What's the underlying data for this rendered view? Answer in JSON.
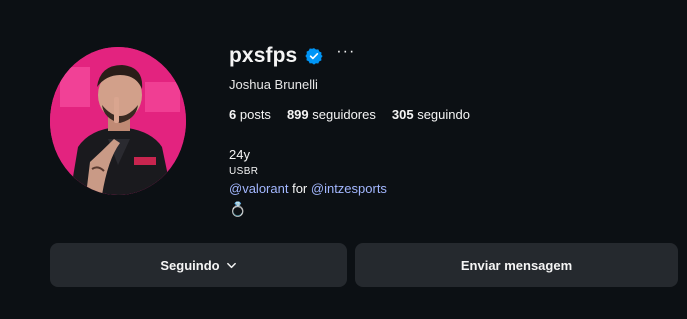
{
  "profile": {
    "username": "pxsfps",
    "full_name": "Joshua Brunelli",
    "more_label": "···",
    "stats": [
      {
        "count": "6",
        "label": "posts"
      },
      {
        "count": "899",
        "label": "seguidores"
      },
      {
        "count": "305",
        "label": "seguindo"
      }
    ],
    "bio": {
      "age": "24y",
      "region": "USBR",
      "mention_game": "@valorant",
      "for_text": "for",
      "mention_team": "@intzesports",
      "ring_emoji": "💍"
    },
    "buttons": {
      "following_label": "Seguindo",
      "message_label": "Enviar mensagem"
    }
  },
  "colors": {
    "background": "#0c1014",
    "button_bg": "#25292e",
    "link": "#a3b7ff",
    "verified": "#0095f6",
    "avatar_accent": "#e01f7d"
  },
  "icons": {
    "verified": "verified-badge-icon",
    "more": "more-options-icon",
    "chevron": "chevron-down-icon"
  }
}
